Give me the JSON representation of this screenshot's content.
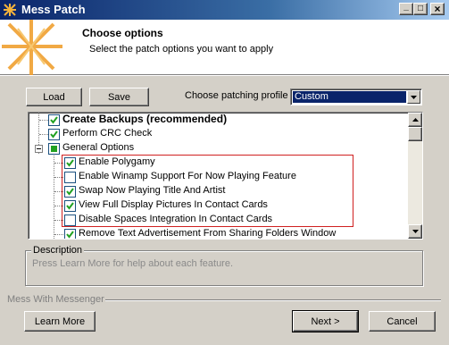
{
  "window": {
    "title": "Mess Patch",
    "caption_minimize": "_",
    "caption_maximize": "□",
    "caption_close": "×"
  },
  "header": {
    "title": "Choose options",
    "subtitle": "Select the patch options you want to apply"
  },
  "toolbar": {
    "load_label": "Load",
    "save_label": "Save"
  },
  "profile": {
    "label": "Choose patching profile",
    "selected": "Custom"
  },
  "options": [
    {
      "label": "Create Backups (recommended)",
      "checked": true,
      "bold": true,
      "level": 1
    },
    {
      "label": "Perform CRC Check",
      "checked": true,
      "bold": false,
      "level": 1
    },
    {
      "label": "General Options",
      "checked": "partial",
      "bold": false,
      "level": 1,
      "expanded": true
    },
    {
      "label": "Enable Polygamy",
      "checked": true,
      "bold": false,
      "level": 2
    },
    {
      "label": "Enable Winamp Support For Now Playing Feature",
      "checked": false,
      "bold": false,
      "level": 2
    },
    {
      "label": "Swap Now Playing Title And Artist",
      "checked": true,
      "bold": false,
      "level": 2
    },
    {
      "label": "View Full Display Pictures In Contact Cards",
      "checked": true,
      "bold": false,
      "level": 2
    },
    {
      "label": "Disable Spaces Integration In Contact Cards",
      "checked": false,
      "bold": false,
      "level": 2
    },
    {
      "label": "Remove Text Advertisement From Sharing Folders Window",
      "checked": true,
      "bold": false,
      "level": 2
    }
  ],
  "description": {
    "group_title": "Description",
    "text": "Press Learn More for help about each feature."
  },
  "footer": {
    "brand": "Mess With Messenger",
    "learn_more_label": "Learn More",
    "next_label": "Next >",
    "cancel_label": "Cancel"
  },
  "colors": {
    "titlebar_start": "#0a246a",
    "checkmark": "#21a121",
    "highlight_border": "#d02020",
    "logo_orange": "#f0a030"
  }
}
